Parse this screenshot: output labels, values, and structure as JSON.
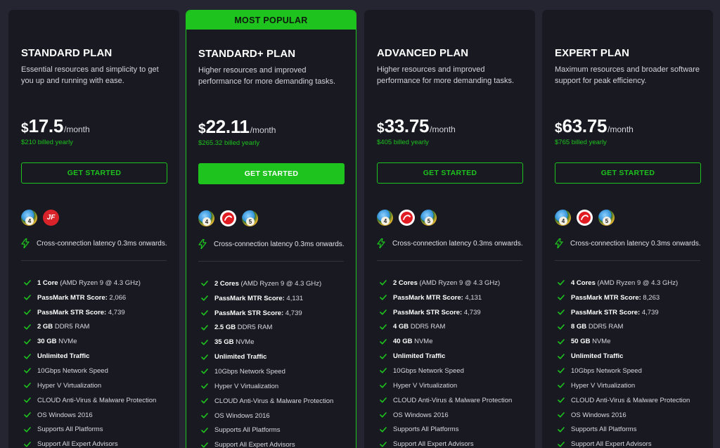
{
  "ribbon": "MOST POPULAR",
  "colors": {
    "accent": "#1ec31e",
    "card_bg": "#181921",
    "page_bg": "#242530"
  },
  "plans": [
    {
      "title": "STANDARD PLAN",
      "description": "Essential resources and simplicity to get you up and running with ease.",
      "currency": "$",
      "price": "17.5",
      "period": "/month",
      "billed": "$210 billed yearly",
      "cta": "GET STARTED",
      "platform_icons": [
        "metatrader-4-icon",
        "jforex-icon"
      ],
      "latency": "Cross-connection latency 0.3ms onwards.",
      "features": [
        {
          "strong": "1 Core",
          "rest": " (AMD Ryzen 9 @ 4.3 GHz)"
        },
        {
          "strong": "PassMark MTR Score:",
          "rest": " 2,066"
        },
        {
          "strong": "PassMark STR Score:",
          "rest": " 4,739"
        },
        {
          "strong": "2 GB",
          "rest": " DDR5 RAM"
        },
        {
          "strong": "30 GB",
          "rest": " NVMe"
        },
        {
          "strong": "Unlimited Traffic",
          "rest": ""
        },
        {
          "strong": "",
          "rest": "10Gbps Network Speed"
        },
        {
          "strong": "",
          "rest": "Hyper V Virtualization"
        },
        {
          "strong": "",
          "rest": "CLOUD Anti-Virus & Malware Protection"
        },
        {
          "strong": "",
          "rest": "OS Windows 2016"
        },
        {
          "strong": "",
          "rest": "Supports All Platforms"
        },
        {
          "strong": "",
          "rest": "Support All Expert Advisors"
        }
      ]
    },
    {
      "title": "STANDARD+ PLAN",
      "description": "Higher resources and improved performance for more demanding tasks.",
      "currency": "$",
      "price": "22.11",
      "period": "/month",
      "billed": "$265.32 billed yearly",
      "cta": "GET STARTED",
      "platform_icons": [
        "metatrader-4-icon",
        "ctrader-icon",
        "metatrader-5-icon"
      ],
      "latency": "Cross-connection latency 0.3ms onwards.",
      "features": [
        {
          "strong": "2 Cores",
          "rest": " (AMD Ryzen 9 @ 4.3 GHz)"
        },
        {
          "strong": "PassMark MTR Score:",
          "rest": " 4,131"
        },
        {
          "strong": "PassMark STR Score:",
          "rest": " 4,739"
        },
        {
          "strong": "2.5 GB",
          "rest": " DDR5 RAM"
        },
        {
          "strong": "35 GB",
          "rest": " NVMe"
        },
        {
          "strong": "Unlimited Traffic",
          "rest": ""
        },
        {
          "strong": "",
          "rest": "10Gbps Network Speed"
        },
        {
          "strong": "",
          "rest": "Hyper V Virtualization"
        },
        {
          "strong": "",
          "rest": "CLOUD Anti-Virus & Malware Protection"
        },
        {
          "strong": "",
          "rest": "OS Windows 2016"
        },
        {
          "strong": "",
          "rest": "Supports All Platforms"
        },
        {
          "strong": "",
          "rest": "Support All Expert Advisors"
        }
      ]
    },
    {
      "title": "ADVANCED PLAN",
      "description": "Higher resources and improved performance for more demanding tasks.",
      "currency": "$",
      "price": "33.75",
      "period": "/month",
      "billed": "$405 billed yearly",
      "cta": "GET STARTED",
      "platform_icons": [
        "metatrader-4-icon",
        "ctrader-icon",
        "metatrader-5-icon"
      ],
      "latency": "Cross-connection latency 0.3ms onwards.",
      "features": [
        {
          "strong": "2 Cores",
          "rest": " (AMD Ryzen 9 @ 4.3 GHz)"
        },
        {
          "strong": "PassMark MTR Score:",
          "rest": " 4,131"
        },
        {
          "strong": "PassMark STR Score:",
          "rest": " 4,739"
        },
        {
          "strong": "4 GB",
          "rest": " DDR5 RAM"
        },
        {
          "strong": "40 GB",
          "rest": " NVMe"
        },
        {
          "strong": "Unlimited Traffic",
          "rest": ""
        },
        {
          "strong": "",
          "rest": "10Gbps Network Speed"
        },
        {
          "strong": "",
          "rest": "Hyper V Virtualization"
        },
        {
          "strong": "",
          "rest": "CLOUD Anti-Virus & Malware Protection"
        },
        {
          "strong": "",
          "rest": "OS Windows 2016"
        },
        {
          "strong": "",
          "rest": "Supports All Platforms"
        },
        {
          "strong": "",
          "rest": "Support All Expert Advisors"
        }
      ]
    },
    {
      "title": "EXPERT PLAN",
      "description": "Maximum resources and broader software support for peak efficiency.",
      "currency": "$",
      "price": "63.75",
      "period": "/month",
      "billed": "$765 billed yearly",
      "cta": "GET STARTED",
      "platform_icons": [
        "metatrader-4-icon",
        "ctrader-icon",
        "metatrader-5-icon"
      ],
      "latency": "Cross-connection latency 0.3ms onwards.",
      "features": [
        {
          "strong": "4 Cores",
          "rest": " (AMD Ryzen 9 @ 4.3 GHz)"
        },
        {
          "strong": "PassMark MTR Score:",
          "rest": " 8,263"
        },
        {
          "strong": "PassMark STR Score:",
          "rest": " 4,739"
        },
        {
          "strong": "8 GB",
          "rest": " DDR5 RAM"
        },
        {
          "strong": "50 GB",
          "rest": " NVMe"
        },
        {
          "strong": "Unlimited Traffic",
          "rest": ""
        },
        {
          "strong": "",
          "rest": "10Gbps Network Speed"
        },
        {
          "strong": "",
          "rest": "Hyper V Virtualization"
        },
        {
          "strong": "",
          "rest": "CLOUD Anti-Virus & Malware Protection"
        },
        {
          "strong": "",
          "rest": "OS Windows 2016"
        },
        {
          "strong": "",
          "rest": "Supports All Platforms"
        },
        {
          "strong": "",
          "rest": "Support All Expert Advisors"
        }
      ]
    }
  ]
}
